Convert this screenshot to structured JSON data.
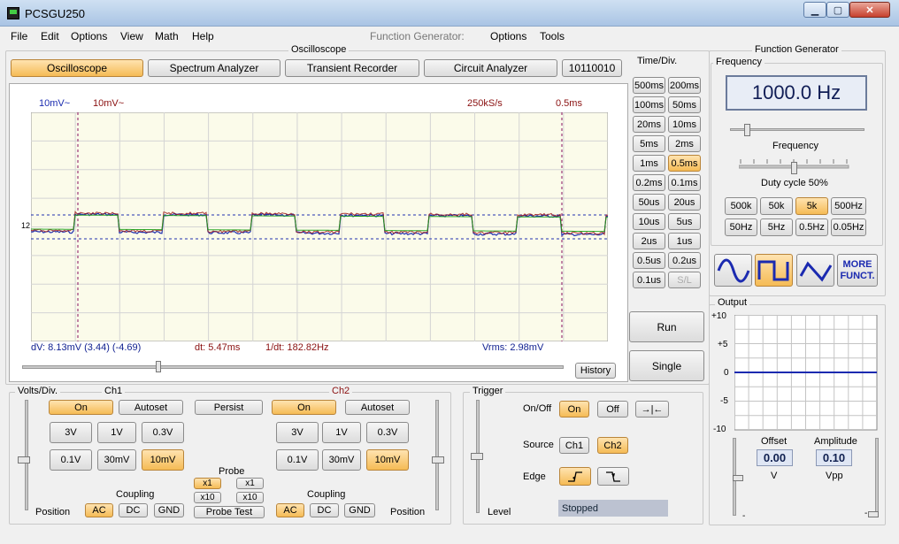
{
  "window": {
    "title": "PCSGU250",
    "min": "0",
    "max": "1",
    "close": "r"
  },
  "menu": {
    "file": "File",
    "edit": "Edit",
    "options": "Options",
    "view": "View",
    "math": "Math",
    "help": "Help",
    "fg_label": "Function Generator:",
    "fg_options": "Options",
    "fg_tools": "Tools"
  },
  "osc": {
    "group_title": "Oscilloscope",
    "tabs": {
      "oscilloscope": "Oscilloscope",
      "spectrum": "Spectrum Analyzer",
      "transient": "Transient Recorder",
      "circuit": "Circuit Analyzer",
      "binary": "10110010"
    },
    "ch1_scale": "10mV~",
    "ch2_scale": "10mV~",
    "samplerate": "250kS/s",
    "timebase": "0.5ms",
    "marker_12": "12",
    "readout_dv": "dV: 8.13mV  (3.44) (-4.69)",
    "readout_dt": "dt: 5.47ms",
    "readout_1dt": "1/dt: 182.82Hz",
    "readout_vrms": "Vrms: 2.98mV",
    "history": "History"
  },
  "timediv": {
    "title": "Time/Div.",
    "buttons": [
      "500ms",
      "200ms",
      "100ms",
      "50ms",
      "20ms",
      "10ms",
      "5ms",
      "2ms",
      "1ms",
      "0.5ms",
      "0.2ms",
      "0.1ms",
      "50us",
      "20us",
      "10us",
      "5us",
      "2us",
      "1us",
      "0.5us",
      "0.2us",
      "0.1us",
      "S/L"
    ],
    "selected": "0.5ms",
    "run": "Run",
    "single": "Single"
  },
  "volts": {
    "title": "Volts/Div.",
    "ch1": "Ch1",
    "ch2": "Ch2",
    "on": "On",
    "autoset": "Autoset",
    "persist": "Persist",
    "v3": "3V",
    "v1": "1V",
    "v03": "0.3V",
    "v01": "0.1V",
    "v30m": "30mV",
    "v10m": "10mV",
    "probe": "Probe",
    "x1": "x1",
    "x10": "x10",
    "probe_test": "Probe Test",
    "coupling": "Coupling",
    "ac": "AC",
    "dc": "DC",
    "gnd": "GND",
    "position": "Position"
  },
  "trigger": {
    "title": "Trigger",
    "onoff": "On/Off",
    "on": "On",
    "off": "Off",
    "fit": "→|←",
    "source": "Source",
    "ch1": "Ch1",
    "ch2": "Ch2",
    "edge": "Edge",
    "level": "Level",
    "status": "Stopped"
  },
  "fg": {
    "title": "Function Generator",
    "freq_group": "Frequency",
    "freq_value": "1000.0 Hz",
    "freq_label": "Frequency",
    "duty": "Duty cycle 50%",
    "ranges": [
      "500k",
      "50k",
      "5k",
      "500Hz",
      "50Hz",
      "5Hz",
      "0.5Hz",
      "0.05Hz"
    ],
    "range_selected": "5k",
    "more": "MORE FUNCT.",
    "output_group": "Output",
    "y_ticks": [
      "+10",
      "+5",
      "0",
      "-5",
      "-10"
    ],
    "offset_label": "Offset",
    "offset_value": "0.00",
    "offset_unit": "V",
    "amp_label": "Amplitude",
    "amp_value": "0.10",
    "amp_unit": "Vpp",
    "minus": "-"
  },
  "colors": {
    "selected": "#f5bb55",
    "ch1": "#1a2bb0",
    "ch2": "#8a1010",
    "grid": "#d4d4d4",
    "scope_bg": "#fbfbea"
  }
}
